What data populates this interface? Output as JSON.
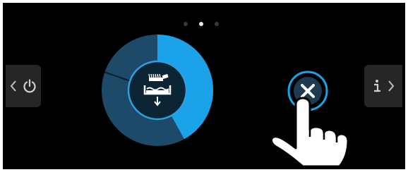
{
  "screen": {
    "pagination": {
      "count": 3,
      "active_index": 1
    },
    "program_progress": 0.42,
    "colors": {
      "progress_done": "#1aa3e8",
      "progress_remaining": "#1c4a68",
      "center_circle": "#0c2535",
      "ring_highlight": "#2f9fe0",
      "close_background": "#1d3a4f"
    },
    "left_tab": {
      "icons": [
        "chevron-left-icon",
        "power-icon"
      ]
    },
    "right_tab": {
      "icons": [
        "info-icon",
        "chevron-right-icon"
      ]
    },
    "center_icon": "basin-drain-icon",
    "close_button": {
      "icon": "close-icon"
    },
    "overlay": {
      "icon": "pointing-hand-icon"
    }
  }
}
